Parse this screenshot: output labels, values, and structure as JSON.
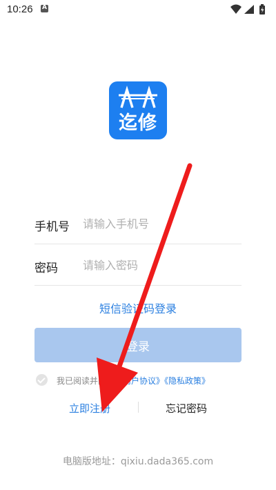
{
  "status_bar": {
    "time": "10:26",
    "notification_letter": "A"
  },
  "logo": {
    "text": "迄修",
    "brand_color": "#1d7ff0"
  },
  "form": {
    "phone_label": "手机号",
    "phone_placeholder": "请输入手机号",
    "phone_value": "",
    "password_label": "密码",
    "password_placeholder": "请输入密码",
    "password_value": ""
  },
  "sms_login_link": "短信验证码登录",
  "login_button": "登录",
  "agreement": {
    "checked": false,
    "prefix": "我已阅读并同意",
    "user_agreement": "《用户协议》",
    "privacy_policy": "《隐私政策》"
  },
  "links": {
    "register": "立即注册",
    "forgot_password": "忘记密码"
  },
  "footer": {
    "pc_address": "电脑版地址：qixiu.dada365.com"
  },
  "colors": {
    "accent": "#2a7fe0",
    "button_disabled": "#a9c7ee",
    "annotation_arrow": "#ee1c1c"
  }
}
